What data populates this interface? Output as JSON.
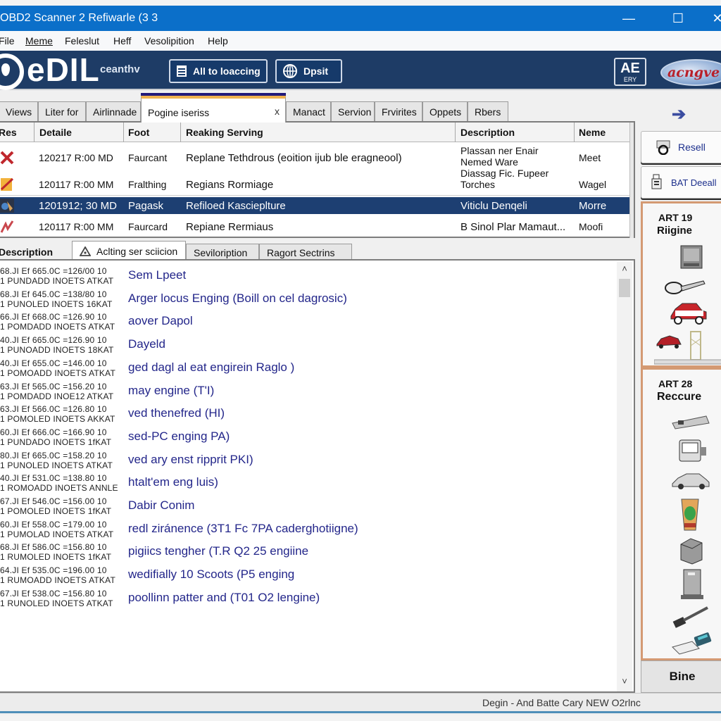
{
  "window": {
    "title": "OBD2 Scanner 2 Refiwarle (3 3",
    "controls": {
      "minimize": "—",
      "maximize": "☐",
      "close": "✕"
    }
  },
  "menu": [
    "File",
    "Meme",
    "Feleslut",
    "Heff",
    "Vesolipition",
    "Help"
  ],
  "banner": {
    "logo_text": "eDIL",
    "logo_sub": "ceanthv",
    "buttons": [
      {
        "label": "All to loaccing",
        "icon": "list-icon"
      },
      {
        "label": "Dpsit",
        "icon": "globe-icon"
      }
    ],
    "badge": {
      "big": "AE",
      "small": "ERY"
    },
    "brand": "acngve"
  },
  "tabs": [
    {
      "label": "Views"
    },
    {
      "label": "Liter for"
    },
    {
      "label": "Airlinnade"
    },
    {
      "label": "Pogine iseriss",
      "active": true,
      "close": "x"
    },
    {
      "label": "Manact"
    },
    {
      "label": "Servion"
    },
    {
      "label": "Frvirites"
    },
    {
      "label": "Oppets"
    },
    {
      "label": "Rbers"
    }
  ],
  "grid": {
    "columns": [
      "Res",
      "Detaile",
      "Foot",
      "Reaking Serving",
      "Description",
      "Neme"
    ],
    "rows": [
      {
        "icon": "error-x-icon",
        "detail": "120217 R:00  MD",
        "foot": "Faurcant",
        "serving": "Replane Tethdrous (eoition ijub ble eragneool)",
        "desc1": "Plassan ner Enair",
        "desc2": "Nemed Ware",
        "name": "Meet"
      },
      {
        "icon": "warning-edit-icon",
        "detail": "120117 R:00  MM",
        "foot": "Fralthing",
        "serving": "Regians Rormiage",
        "desc1": "Diassag Fic. Fupeer",
        "desc2": "Torches",
        "name": "Wagel"
      },
      {
        "icon": "tool-icon",
        "detail": "1201912; 30 MD",
        "foot": "Pagask",
        "serving": "Refiloed Kascieplture",
        "desc1": "Viticlu Denqeli",
        "desc2": "",
        "name": "Morre",
        "selected": true
      },
      {
        "icon": "check-mark-icon",
        "detail": "120117 R:00  MM",
        "foot": "Faurcard",
        "serving": "Repiane Rermiaus",
        "desc1": "B Sinol Plar Mamaut...",
        "desc2": "",
        "name": "Moofi"
      }
    ]
  },
  "subtabs": [
    {
      "label": "Description"
    },
    {
      "label": "Aclting ser sciicion",
      "active": true,
      "icon": "warning-triangle-icon"
    },
    {
      "label": "Seviloription"
    },
    {
      "label": "Ragort Sectrins"
    }
  ],
  "details": [
    {
      "code1": "68.JI Ef 665.0C =126/00 10",
      "code2": "1 PUNDADD INOETS ATKAT",
      "text": "Sem Lpeet"
    },
    {
      "code1": "68.JI Ef 645.0C =138/80 10",
      "code2": "1 PUNOLED INOETS 16KAT",
      "text": "Arger locus Enging   (Boill on cel dagrosic)"
    },
    {
      "code1": "66.JI Ef 668.0C =126.90 10",
      "code2": "1 POMDADD INOETS ATKAT",
      "text": "aover Dapol"
    },
    {
      "code1": "40.JI Ef 665.0C =126.90 10",
      "code2": "1 PUNOADD INOETS 18KAT",
      "text": "Dayeld"
    },
    {
      "code1": "40.JI Ef 655.0C =146.00 10",
      "code2": "1 POMOADD INOETS ATKAT",
      "text": "ged dagl al eat engirein Raglo )"
    },
    {
      "code1": "63.JI Ef 565.0C =156.20 10",
      "code2": "1 POMDADD INOE12 ATKAT",
      "text": "may engine (T'I)"
    },
    {
      "code1": "63.JI Ef 566.0C =126.80 10",
      "code2": "1 POMOLED INOETS AKKAT",
      "text": "ved thenefred (HI)"
    },
    {
      "code1": "60.JI Ef 666.0C =166.90 10",
      "code2": "1 PUNDADO INOETS 1fKAT",
      "text": "sed-PC enging PA)"
    },
    {
      "code1": "80.JI Ef 665.0C =158.20 10",
      "code2": "1 PUNOLED INOETS ATKAT",
      "text": "ved ary enst ripprit PKI)"
    },
    {
      "code1": "40.JI Ef 531.0C =138.80 10",
      "code2": "1 ROMOADD INOETS ANNLE",
      "text": "htalt'em eng luis)"
    },
    {
      "code1": "67.JI Ef 546.0C =156.00 10",
      "code2": "1 POMOLED INOETS 1fKAT",
      "text": "Dabir Conim"
    },
    {
      "code1": "60.JI Ef 558.0C =179.00 10",
      "code2": "1 PUMOLAD INOETS ATKAT",
      "text": "redl ziránence (3T1 Fc 7PA caderghotiigne)"
    },
    {
      "code1": "68.JI Ef 586.0C =156.80 10",
      "code2": "1 RUMOLED INOETS 1fKAT",
      "text": "pigiics tengher (T.R Q2 25 engiine"
    },
    {
      "code1": "64.JI Ef 535.0C =196.00 10",
      "code2": "1 RUMOADD INOETS ATKAT",
      "text": "wedifially 10 Scoots (P5 enging"
    },
    {
      "code1": "67.JI Ef 538.0C =156.80 10",
      "code2": "1 RUNOLED INOETS ATKAT",
      "text": "poollinn patter and (T01 O2 lengine)"
    }
  ],
  "sidebar": {
    "back_icon": "back-arrow-icon",
    "buttons": [
      {
        "label": "Resell",
        "icon": "printer-icon"
      },
      {
        "label": "BAT Deeall",
        "icon": "battery-tool-icon"
      }
    ],
    "panels": [
      {
        "code": "ART 19",
        "title": "Riigine",
        "items": [
          "engine-box-icon",
          "exhaust-pipe-icon",
          "red-car-icon",
          "car-lift-icon"
        ]
      },
      {
        "code": "ART 28",
        "title": "Reccure",
        "items": [
          "module-strip-icon",
          "scanner-device-icon",
          "sedan-car-icon",
          "fluid-cup-icon",
          "ecu-box-icon",
          "tower-unit-icon",
          "cable-connector-icon",
          "calculator-icon"
        ]
      }
    ],
    "bottom_button": "Bine"
  },
  "status": "Degin  -  And Batte Cary NEW  O2rlnc",
  "colors": {
    "titlebar": "#0b6fc9",
    "banner": "#1e3c66",
    "selected_row": "#1d3f72",
    "link_text": "#23268a",
    "panel_border": "#d49a73"
  }
}
